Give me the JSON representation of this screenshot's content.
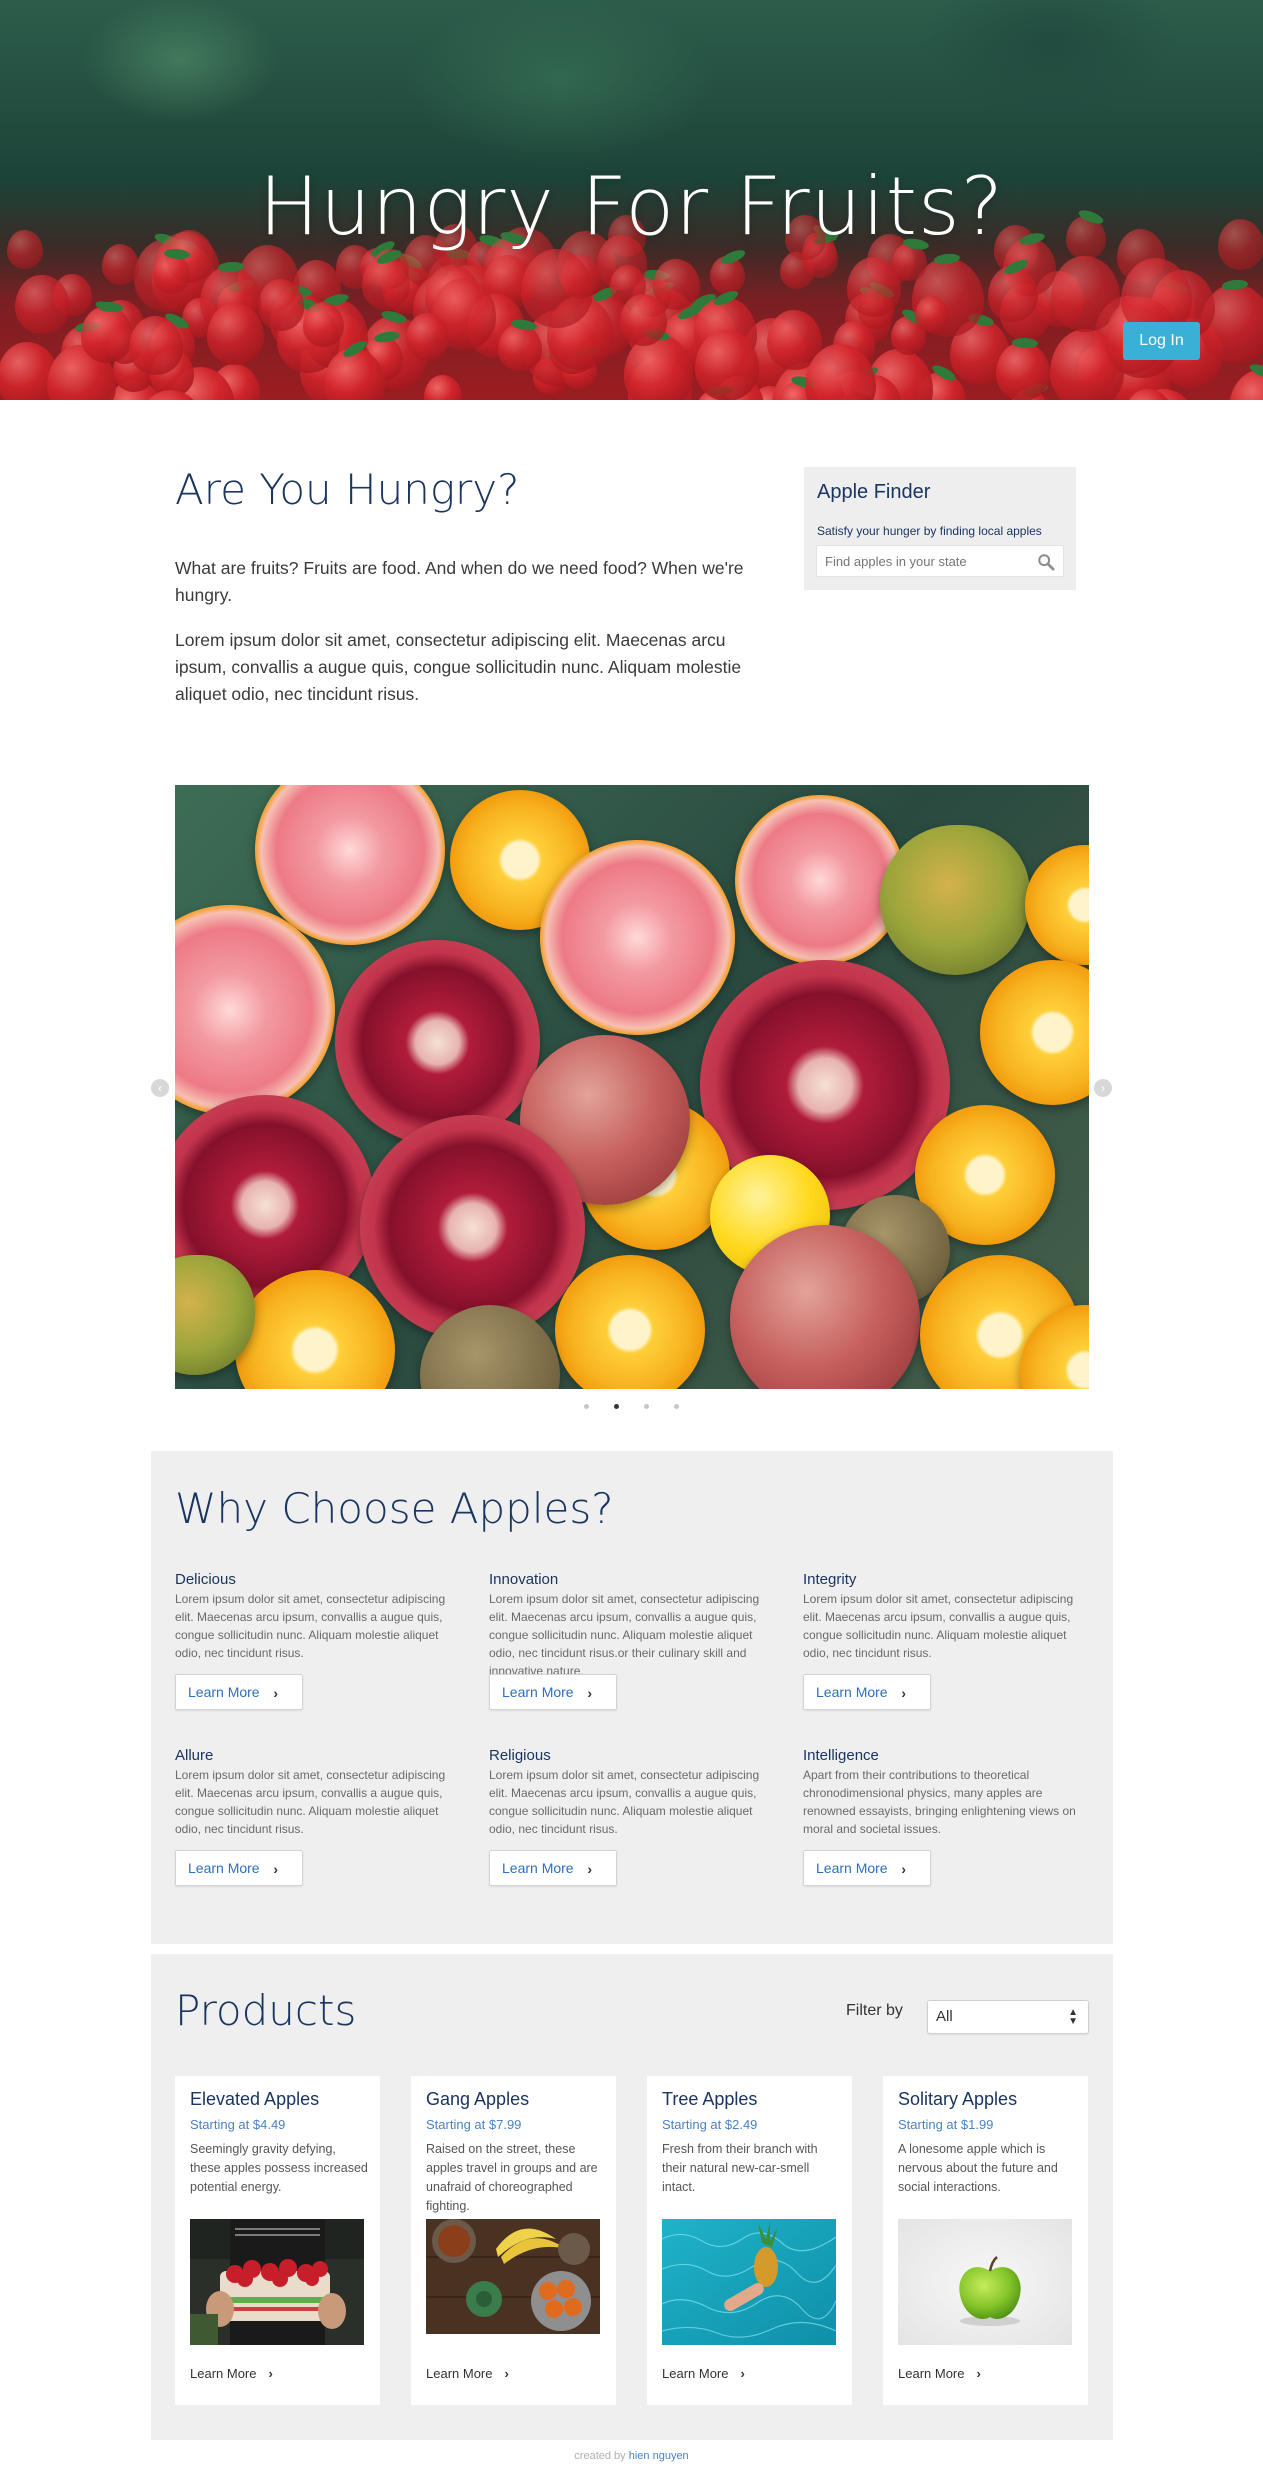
{
  "hero": {
    "title": "Hungry For Fruits?",
    "login_label": "Log In"
  },
  "intro": {
    "title": "Are You Hungry?",
    "paragraph1": "What are fruits? Fruits are food. And when do we need food? When we're hungry.",
    "paragraph2": "Lorem ipsum dolor sit amet, consectetur adipiscing elit. Maecenas arcu ipsum, convallis a augue quis, congue sollicitudin nunc. Aliquam molestie aliquet odio, nec tincidunt risus."
  },
  "finder": {
    "title": "Apple Finder",
    "subtitle": "Satisfy your hunger by finding local apples",
    "placeholder": "Find apples in your state"
  },
  "carousel": {
    "prev_icon": "‹",
    "next_icon": "›",
    "slide_count": 4,
    "active_index": 1
  },
  "why": {
    "title": "Why Choose Apples?",
    "features": [
      {
        "title": "Delicious",
        "desc": "Lorem ipsum dolor sit amet, consectetur adipiscing elit. Maecenas arcu ipsum, convallis a augue quis, congue sollicitudin nunc. Aliquam molestie aliquet odio, nec tincidunt risus.",
        "button": "Learn More"
      },
      {
        "title": "Innovation",
        "desc": "Lorem ipsum dolor sit amet, consectetur adipiscing elit. Maecenas arcu ipsum, convallis a augue quis, congue sollicitudin nunc. Aliquam molestie aliquet odio, nec tincidunt risus.or their culinary skill and innovative nature.",
        "button": "Learn More"
      },
      {
        "title": "Integrity",
        "desc": "Lorem ipsum dolor sit amet, consectetur adipiscing elit. Maecenas arcu ipsum, convallis a augue quis, congue sollicitudin nunc. Aliquam molestie aliquet odio, nec tincidunt risus.",
        "button": "Learn More"
      },
      {
        "title": "Allure",
        "desc": "Lorem ipsum dolor sit amet, consectetur adipiscing elit. Maecenas arcu ipsum, convallis a augue quis, congue sollicitudin nunc. Aliquam molestie aliquet odio, nec tincidunt risus.",
        "button": "Learn More"
      },
      {
        "title": "Religious",
        "desc": "Lorem ipsum dolor sit amet, consectetur adipiscing elit. Maecenas arcu ipsum, convallis a augue quis, congue sollicitudin nunc. Aliquam molestie aliquet odio, nec tincidunt risus.",
        "button": "Learn More"
      },
      {
        "title": "Intelligence",
        "desc": "Apart from their contributions to theoretical chronodimensional physics, many apples are renowned essayists, bringing enlightening views on moral and societal issues.",
        "button": "Learn More"
      }
    ]
  },
  "products": {
    "title": "Products",
    "filter_label": "Filter by",
    "filter_value": "All",
    "items": [
      {
        "name": "Elevated Apples",
        "price": "Starting at $4.49",
        "desc": "Seemingly gravity defying, these apples possess increased potential energy.",
        "link": "Learn More"
      },
      {
        "name": "Gang Apples",
        "price": "Starting at $7.99",
        "desc": "Raised on the street, these apples travel in groups and are unafraid of choreographed fighting.",
        "link": "Learn More"
      },
      {
        "name": "Tree Apples",
        "price": "Starting at $2.49",
        "desc": "Fresh from their branch with their natural new-car-smell intact.",
        "link": "Learn More"
      },
      {
        "name": "Solitary Apples",
        "price": "Starting at $1.99",
        "desc": "A lonesome apple which is nervous about the future and social interactions.",
        "link": "Learn More"
      }
    ]
  },
  "footer": {
    "prefix": "created by",
    "author": "hien nguyen"
  },
  "colors": {
    "heading": "#1a3560",
    "login_button": "#3bb0d6",
    "link": "#2e6fbc",
    "section_bg": "#efefef"
  },
  "icons": {
    "search": "magnifier-icon",
    "chevron": "chevron-right-icon"
  }
}
